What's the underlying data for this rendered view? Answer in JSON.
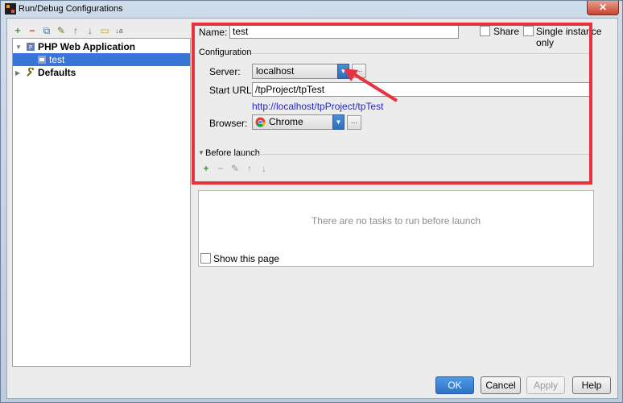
{
  "window": {
    "title": "Run/Debug Configurations",
    "close": "✕"
  },
  "toolbar": {
    "add": "+",
    "remove": "−",
    "copy": "⧉",
    "edit": "✎",
    "up": "↑",
    "down": "↓",
    "folder": "▭",
    "sort": "↓a"
  },
  "tree": {
    "items": [
      {
        "label": "PHP Web Application",
        "expanded": true
      },
      {
        "label": "test",
        "selected": true
      },
      {
        "label": "Defaults",
        "expanded": false
      }
    ]
  },
  "form": {
    "name_label": "Name:",
    "name_value": "test",
    "share_label": "Share",
    "single_instance_label": "Single instance only",
    "configuration_heading": "Configuration",
    "server_label": "Server:",
    "server_value": "localhost",
    "start_url_label": "Start URL:",
    "start_url_value": "/tpProject/tpTest",
    "full_url": "http://localhost/tpProject/tpTest",
    "browser_label": "Browser:",
    "browser_value": "Chrome",
    "ellipsis": "...",
    "before_launch_heading": "Before launch",
    "tasks_empty": "There are no tasks to run before launch",
    "show_page_label": "Show this page"
  },
  "buttons": {
    "ok": "OK",
    "cancel": "Cancel",
    "apply": "Apply",
    "help": "Help"
  },
  "colors": {
    "highlight": "#e8333f",
    "selection": "#3875d7",
    "link": "#2525c9"
  }
}
